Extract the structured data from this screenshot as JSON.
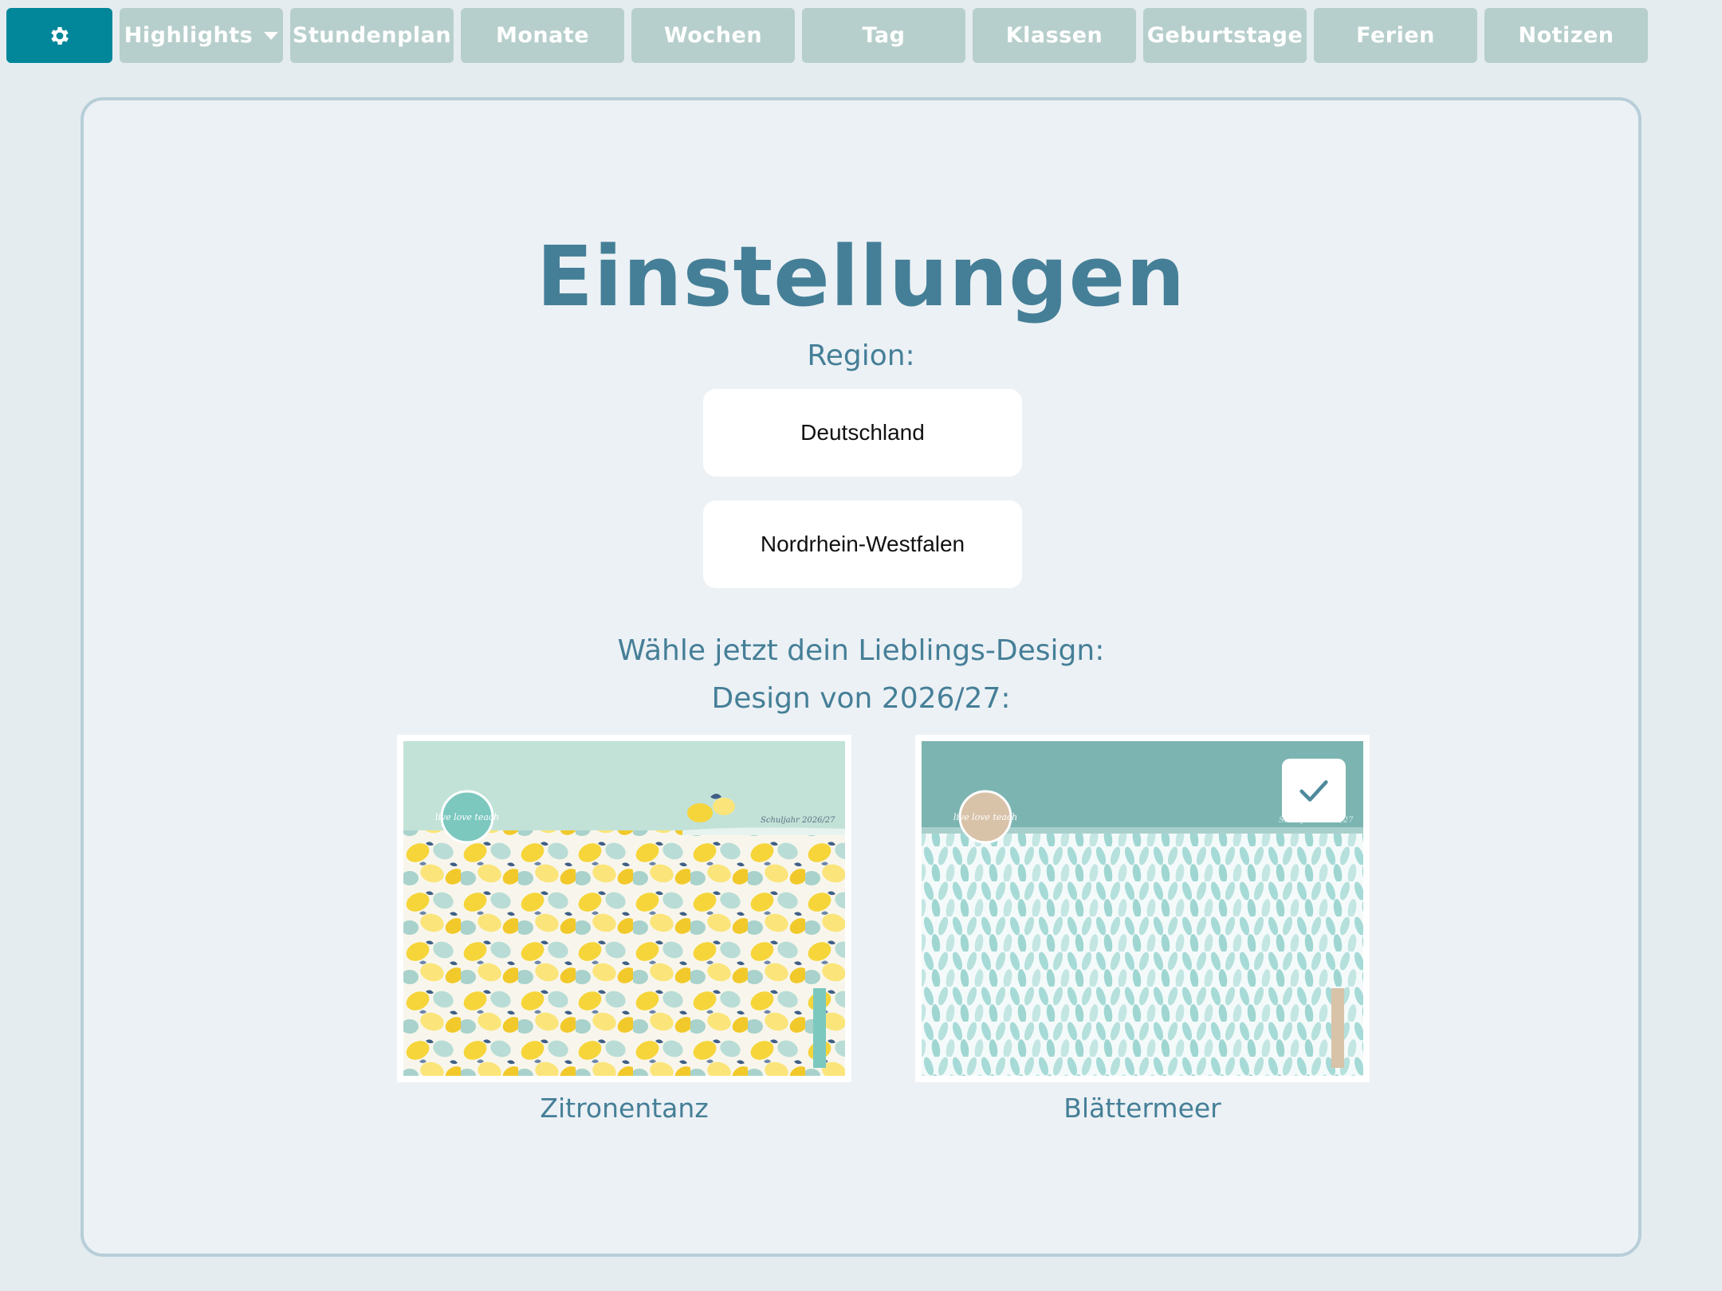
{
  "nav": {
    "settings_icon": "gear-icon",
    "items": [
      {
        "label": "Highlights",
        "has_dropdown": true
      },
      {
        "label": "Stundenplan"
      },
      {
        "label": "Monate"
      },
      {
        "label": "Wochen"
      },
      {
        "label": "Tag"
      },
      {
        "label": "Klassen"
      },
      {
        "label": "Geburtstage"
      },
      {
        "label": "Ferien"
      },
      {
        "label": "Notizen"
      }
    ]
  },
  "settings": {
    "title": "Einstellungen",
    "region_label": "Region:",
    "country": "Deutschland",
    "state": "Nordrhein-Westfalen",
    "design_prompt": "Wähle jetzt dein Lieblings-Design:",
    "design_year": "Design von 2026/27:",
    "designs": [
      {
        "name": "Zitronentanz",
        "selected": false,
        "thumb_text": "Schuljahr 2026/27",
        "logo_text": "live love teach"
      },
      {
        "name": "Blättermeer",
        "selected": true,
        "thumb_text": "Schuljahr 2026/27",
        "logo_text": "live love teach"
      }
    ]
  },
  "colors": {
    "accent": "#01869a",
    "nav_inactive": "#b7cfcc",
    "heading": "#457f97",
    "panel_bg": "#ecf1f5",
    "panel_border": "#b7ced8"
  }
}
